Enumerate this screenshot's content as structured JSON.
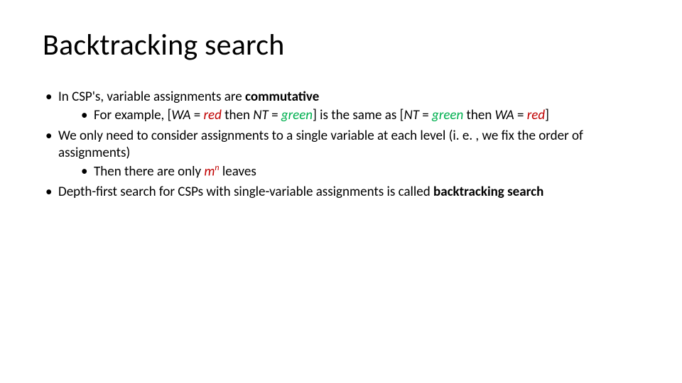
{
  "title": "Backtracking search",
  "b1_pre": "In CSP's, variable assignments are ",
  "b1_bold": "commutative",
  "b1s1_pre": "For example, [",
  "b1s1_wa1": "WA",
  "b1s1_eq1": " = ",
  "b1s1_red1": "red",
  "b1s1_then1": " then ",
  "b1s1_nt1": "NT",
  "b1s1_eq2": " = ",
  "b1s1_green1": "green",
  "b1s1_mid": "] is the same as [",
  "b1s1_nt2": "NT",
  "b1s1_eq3": " = ",
  "b1s1_green2": "green",
  "b1s1_then2": " then ",
  "b1s1_wa2": "WA",
  "b1s1_eq4": " = ",
  "b1s1_red2": "red",
  "b1s1_close": "]",
  "b2": "We only need to consider assignments to a single variable at each level (i. e. , we fix the order of assignments)",
  "b2s1_pre": " Then there are only ",
  "b2s1_m": "m",
  "b2s1_n": "n",
  "b2s1_post": " leaves",
  "b3_pre": "Depth-first search for CSPs with single-variable assignments is called ",
  "b3_bold": "backtracking search"
}
